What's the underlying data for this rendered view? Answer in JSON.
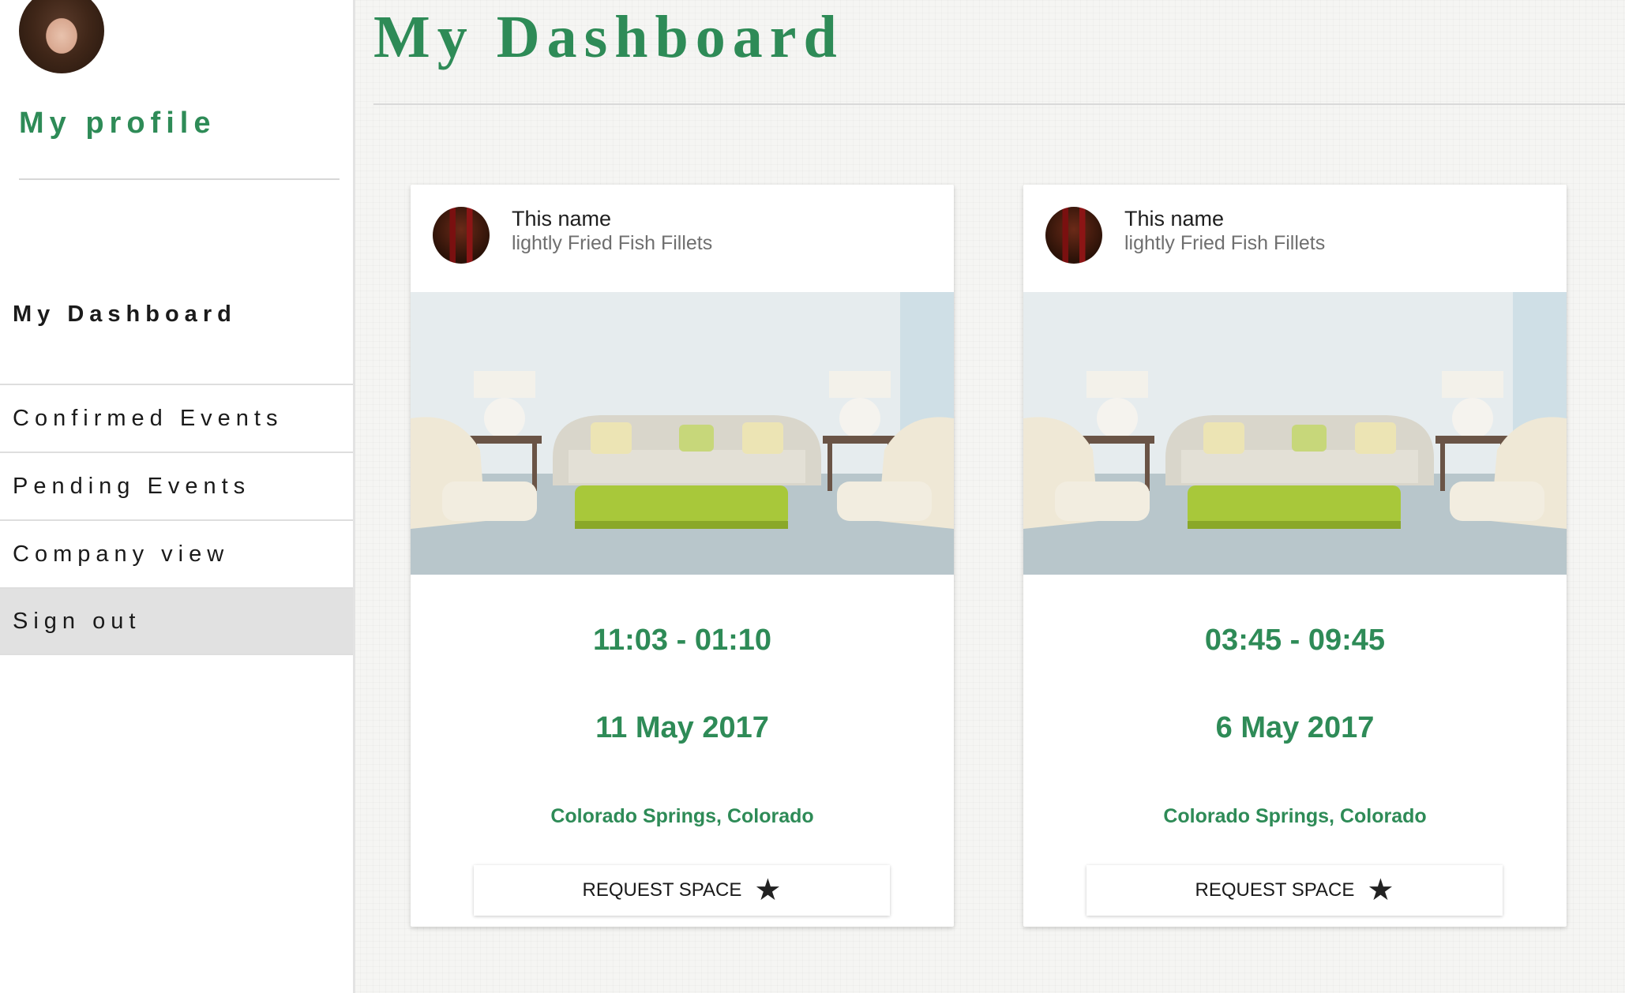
{
  "sidebar": {
    "profile_title": "My profile",
    "dashboard_heading": "My Dashboard",
    "items": [
      {
        "label": "Confirmed Events"
      },
      {
        "label": "Pending Events"
      },
      {
        "label": "Company view"
      },
      {
        "label": "Sign out"
      }
    ]
  },
  "main": {
    "title": "My Dashboard",
    "cards": [
      {
        "name": "This name",
        "subtitle": "lightly Fried Fish Fillets",
        "time": "11:03 - 01:10",
        "date": "11 May 2017",
        "location": "Colorado Springs, Colorado",
        "button_label": "REQUEST SPACE",
        "button_icon": "star-icon"
      },
      {
        "name": "This name",
        "subtitle": "lightly Fried Fish Fillets",
        "time": "03:45 - 09:45",
        "date": "6 May 2017",
        "location": "Colorado Springs, Colorado",
        "button_label": "REQUEST SPACE",
        "button_icon": "star-icon"
      }
    ]
  },
  "colors": {
    "accent": "#2e8b57",
    "active_nav_bg": "#e1e1e1"
  }
}
